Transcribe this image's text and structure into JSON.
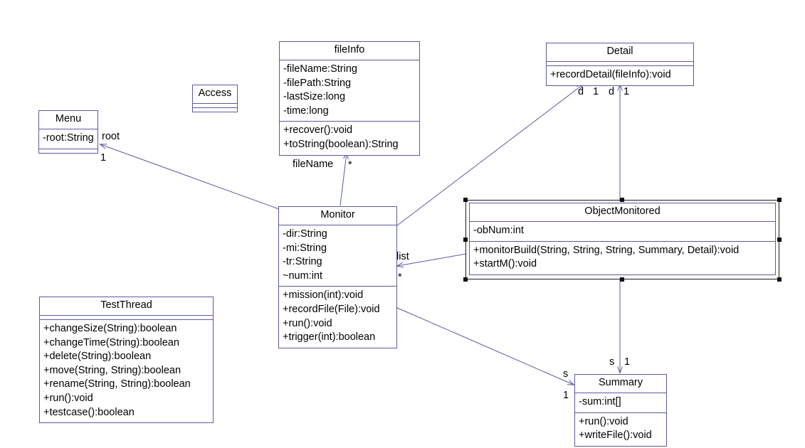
{
  "diagram": {
    "type": "uml-class-diagram",
    "line_color": "#5a5aa0",
    "border_color": "#5a5aa0",
    "selection_color": "#111111",
    "background": "#ffffff"
  },
  "classes": {
    "menu": {
      "name": "Menu",
      "attributes": [
        "-root:String"
      ],
      "methods": []
    },
    "access": {
      "name": "Access",
      "attributes": [],
      "methods": []
    },
    "fileinfo": {
      "name": "fileInfo",
      "attributes": [
        "-fileName:String",
        "-filePath:String",
        "-lastSize:long",
        "-time:long"
      ],
      "methods": [
        "+recover():void",
        "+toString(boolean):String"
      ]
    },
    "detail": {
      "name": "Detail",
      "attributes": [],
      "methods": [
        "+recordDetail(fileInfo):void"
      ]
    },
    "monitor": {
      "name": "Monitor",
      "attributes": [
        "-dir:String",
        "-mi:String",
        "-tr:String",
        "~num:int"
      ],
      "methods": [
        "+mission(int):void",
        "+recordFile(File):void",
        "+run():void",
        "+trigger(int):boolean"
      ]
    },
    "objectmonitored": {
      "name": "ObjectMonitored",
      "attributes": [
        "-obNum:int"
      ],
      "methods": [
        "+monitorBuild(String, String, String, Summary, Detail):void",
        "+startM():void"
      ],
      "selected": true
    },
    "testthread": {
      "name": "TestThread",
      "attributes": [],
      "methods": [
        "+changeSize(String):boolean",
        "+changeTime(String):boolean",
        "+delete(String):boolean",
        "+move(String, String):boolean",
        "+rename(String, String):boolean",
        "+run():void",
        "+testcase():boolean"
      ]
    },
    "summary": {
      "name": "Summary",
      "attributes": [
        "-sum:int[]"
      ],
      "methods": [
        "+run():void",
        "+writeFile():void"
      ]
    }
  },
  "edge_labels": {
    "menu_root": "root",
    "menu_one": "1",
    "filename_role": "fileName",
    "filename_mult": "*",
    "detail_d_left": "d",
    "detail_one_left": "1",
    "detail_d_right": "d",
    "detail_one_right": "1",
    "list_role": "list",
    "list_mult": "*",
    "summary_s_top": "s",
    "summary_one_top": "1",
    "summary_s_left": "s",
    "summary_one_left": "1"
  }
}
